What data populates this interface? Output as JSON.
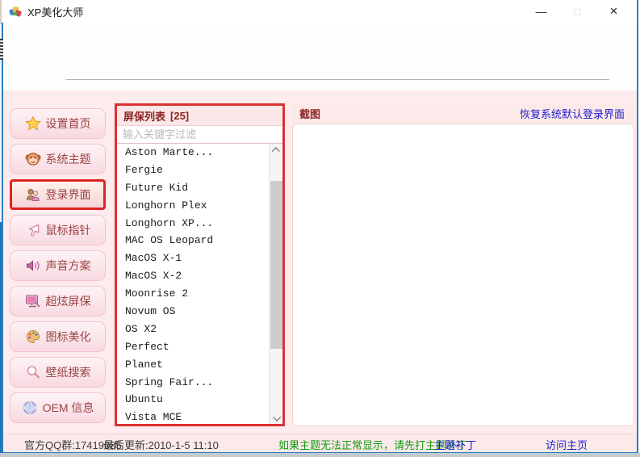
{
  "window": {
    "title": "XP美化大师",
    "controls": {
      "minimize": "—",
      "maximize": "□",
      "close": "×"
    }
  },
  "sidebar": {
    "items": [
      {
        "label": "设置首页",
        "icon": "star-icon"
      },
      {
        "label": "系统主题",
        "icon": "monkey-icon"
      },
      {
        "label": "登录界面",
        "icon": "users-icon",
        "selected": true
      },
      {
        "label": "鼠标指针",
        "icon": "cursor-icon"
      },
      {
        "label": "声音方案",
        "icon": "speaker-icon"
      },
      {
        "label": "超炫屏保",
        "icon": "monitor-icon"
      },
      {
        "label": "图标美化",
        "icon": "palette-icon"
      },
      {
        "label": "壁纸搜索",
        "icon": "magnifier-icon"
      },
      {
        "label": "OEM 信息",
        "icon": "globe-icon"
      }
    ]
  },
  "screensaver_panel": {
    "title": "屏保列表",
    "count": "[25]",
    "search_placeholder": "输入关键字过滤",
    "items": [
      "Aston Marte...",
      "Fergie",
      "Future Kid",
      "Longhorn Plex",
      "Longhorn XP...",
      "MAC OS Leopard",
      "MacOS X-1",
      "MacOS X-2",
      "Moonrise 2",
      "Novum OS",
      "OS X2",
      "Perfect",
      "Planet",
      "Spring Fair...",
      "Ubuntu",
      "Vista MCE"
    ]
  },
  "preview_panel": {
    "title": "截图",
    "restore_link": "恢复系统默认登录界面"
  },
  "statusbar": {
    "qq_group": "官方QQ群:17419085",
    "last_update": "最后更新:2010-1-5 11:10",
    "patch_notice": "如果主题无法正常显示，请先打主题补丁",
    "patch_link": "主题补丁",
    "home_link": "访问主页"
  },
  "colors": {
    "highlight_red": "#dc3032",
    "link_blue": "#1b1bcf",
    "notice_green": "#129912",
    "header_maroon": "#8b2323",
    "window_border_blue": "#2e7dbe"
  }
}
